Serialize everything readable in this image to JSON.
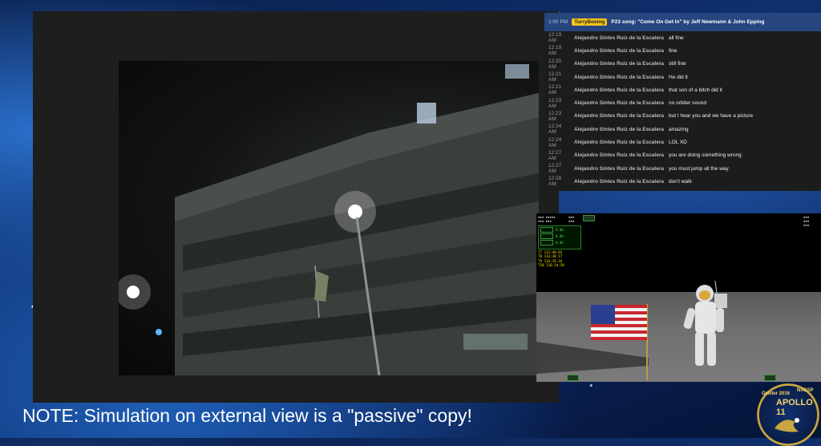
{
  "note": "NOTE: Simulation on external view is a \"passive\" copy!",
  "chat": {
    "pinned": {
      "time": "1:00 PM",
      "user": "TurryBoeing",
      "message": "P23 song: \"Come On Get In\" by Jeff Newmann & John Epping"
    },
    "messages": [
      {
        "time": "12:19 AM",
        "author": "Alejandro Sintes Ruiz de la Escalera",
        "text": "all fine"
      },
      {
        "time": "12:19 AM",
        "author": "Alejandro Sintes Ruiz de la Escalera",
        "text": "fine"
      },
      {
        "time": "12:20 AM",
        "author": "Alejandro Sintes Ruiz de la Escalera",
        "text": "still fine"
      },
      {
        "time": "12:21 AM",
        "author": "Alejandro Sintes Ruiz de la Escalera",
        "text": "He did it"
      },
      {
        "time": "12:21 AM",
        "author": "Alejandro Sintes Ruiz de la Escalera",
        "text": "that son of a bitch did it"
      },
      {
        "time": "12:23 AM",
        "author": "Alejandro Sintes Ruiz de la Escalera",
        "text": "no orbiter sound"
      },
      {
        "time": "12:23 AM",
        "author": "Alejandro Sintes Ruiz de la Escalera",
        "text": "but I hear you and we have a picture"
      },
      {
        "time": "12:24 AM",
        "author": "Alejandro Sintes Ruiz de la Escalera",
        "text": "amazing"
      },
      {
        "time": "12:24 AM",
        "author": "Alejandro Sintes Ruiz de la Escalera",
        "text": "LOL XD"
      },
      {
        "time": "12:27 AM",
        "author": "Alejandro Sintes Ruiz de la Escalera",
        "text": "you are doing something wrong"
      },
      {
        "time": "12:27 AM",
        "author": "Alejandro Sintes Ruiz de la Escalera",
        "text": "you must jump all the way"
      },
      {
        "time": "12:28 AM",
        "author": "Alejandro Sintes Ruiz de la Escalera",
        "text": "don't walk"
      }
    ]
  },
  "sim": {
    "hud_values": [
      "0.00",
      "0.00",
      "0.00"
    ],
    "events": [
      "T7 112:40:02",
      "T8 114:38:17",
      "T9 116:35:34",
      "T10 118:34:50"
    ]
  },
  "logo": {
    "mission": "APOLLO 11",
    "org": "NASSP",
    "edition": "Orbiter 2016"
  },
  "colors": {
    "chat_pinned_bg": "#27457e",
    "username_badge": "#f5c518",
    "hud_green": "#4dd24d",
    "event_yellow": "#f5e300"
  }
}
